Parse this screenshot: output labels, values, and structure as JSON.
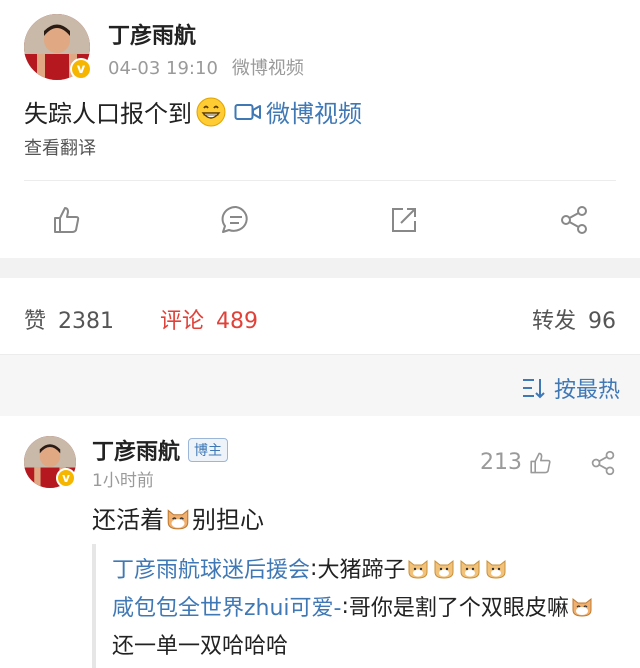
{
  "post": {
    "author": "丁彦雨航",
    "time": "04-03 19:10",
    "source": "微博视频",
    "text": "失踪人口报个到",
    "video_link": "微博视频",
    "translate": "查看翻译",
    "verified_badge": "v",
    "icons": [
      "like-icon",
      "comment-icon",
      "repost-icon",
      "share-icon"
    ]
  },
  "stats": {
    "likes_label": "赞",
    "likes": "2381",
    "comments_label": "评论",
    "comments": "489",
    "reposts_label": "转发",
    "reposts": "96"
  },
  "sort": {
    "label": "按最热"
  },
  "comment": {
    "author": "丁彦雨航",
    "badge": "博主",
    "time": "1小时前",
    "likes": "213",
    "text_before": "还活着",
    "text_after": "别担心",
    "replies": [
      {
        "user": "丁彦雨航球迷后援会",
        "text": "大猪蹄子"
      },
      {
        "user": "咸包包全世界zhui可爱-",
        "text": "哥你是割了个双眼皮嘛"
      },
      {
        "user": "",
        "text": "还一单一双哈哈哈"
      }
    ]
  },
  "colors": {
    "link": "#3f78b5",
    "active": "#e0423a",
    "muted": "#9a9a9a",
    "verified": "#f6b600"
  }
}
